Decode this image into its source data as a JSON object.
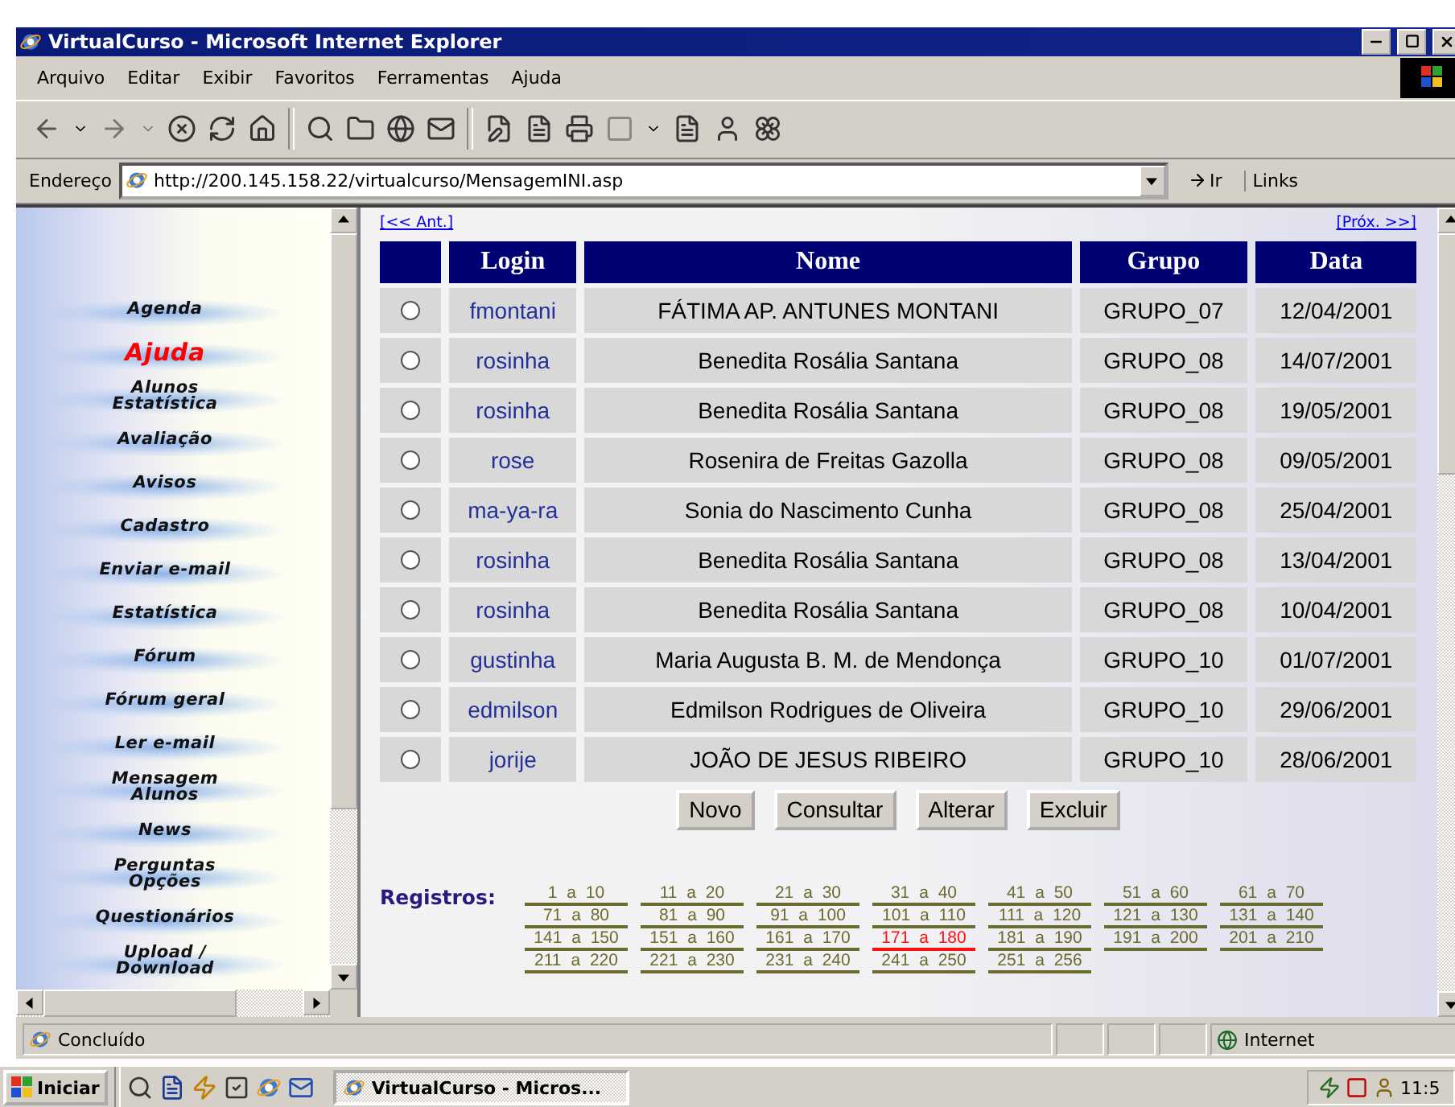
{
  "window": {
    "title": "VirtualCurso - Microsoft Internet Explorer"
  },
  "menu": [
    "Arquivo",
    "Editar",
    "Exibir",
    "Favoritos",
    "Ferramentas",
    "Ajuda"
  ],
  "address": {
    "label": "Endereço",
    "value": "http://200.145.158.22/virtualcurso/MensagemINI.asp",
    "go": "Ir",
    "links": "Links"
  },
  "sidebar": {
    "items": [
      {
        "lines": [
          "Agenda"
        ],
        "selected": false
      },
      {
        "lines": [
          "Ajuda"
        ],
        "selected": true
      },
      {
        "lines": [
          "Alunos",
          "Estatística"
        ],
        "selected": false
      },
      {
        "lines": [
          "Avaliação"
        ],
        "selected": false
      },
      {
        "lines": [
          "Avisos"
        ],
        "selected": false
      },
      {
        "lines": [
          "Cadastro"
        ],
        "selected": false
      },
      {
        "lines": [
          "Enviar e-mail"
        ],
        "selected": false
      },
      {
        "lines": [
          "Estatística"
        ],
        "selected": false
      },
      {
        "lines": [
          "Fórum"
        ],
        "selected": false
      },
      {
        "lines": [
          "Fórum geral"
        ],
        "selected": false
      },
      {
        "lines": [
          "Ler e-mail"
        ],
        "selected": false
      },
      {
        "lines": [
          "Mensagem",
          "Alunos"
        ],
        "selected": false
      },
      {
        "lines": [
          "News"
        ],
        "selected": false
      },
      {
        "lines": [
          "Perguntas",
          "Opções"
        ],
        "selected": false
      },
      {
        "lines": [
          "Questionários"
        ],
        "selected": false
      },
      {
        "lines": [
          "Upload /",
          "Download"
        ],
        "selected": false
      }
    ]
  },
  "content": {
    "prev": "[<< Ant.]",
    "next": "[Próx. >>]",
    "table": {
      "columns": [
        "Login",
        "Nome",
        "Grupo",
        "Data"
      ],
      "rows": [
        {
          "selected": false,
          "login": "fmontani",
          "nome": "FÁTIMA AP. ANTUNES MONTANI",
          "grupo": "GRUPO_07",
          "data": "12/04/2001"
        },
        {
          "selected": false,
          "login": "rosinha",
          "nome": "Benedita Rosália Santana",
          "grupo": "GRUPO_08",
          "data": "14/07/2001"
        },
        {
          "selected": false,
          "login": "rosinha",
          "nome": "Benedita Rosália Santana",
          "grupo": "GRUPO_08",
          "data": "19/05/2001"
        },
        {
          "selected": false,
          "login": "rose",
          "nome": "Rosenira de Freitas Gazolla",
          "grupo": "GRUPO_08",
          "data": "09/05/2001"
        },
        {
          "selected": false,
          "login": "ma-ya-ra",
          "nome": "Sonia do Nascimento Cunha",
          "grupo": "GRUPO_08",
          "data": "25/04/2001"
        },
        {
          "selected": false,
          "login": "rosinha",
          "nome": "Benedita Rosália Santana",
          "grupo": "GRUPO_08",
          "data": "13/04/2001"
        },
        {
          "selected": false,
          "login": "rosinha",
          "nome": "Benedita Rosália Santana",
          "grupo": "GRUPO_08",
          "data": "10/04/2001"
        },
        {
          "selected": false,
          "login": "gustinha",
          "nome": "Maria Augusta B. M. de Mendonça",
          "grupo": "GRUPO_10",
          "data": "01/07/2001"
        },
        {
          "selected": false,
          "login": "edmilson",
          "nome": "Edmilson Rodrigues de Oliveira",
          "grupo": "GRUPO_10",
          "data": "29/06/2001"
        },
        {
          "selected": false,
          "login": "jorije",
          "nome": "JOÃO DE JESUS RIBEIRO",
          "grupo": "GRUPO_10",
          "data": "28/06/2001"
        }
      ]
    },
    "buttons": [
      "Novo",
      "Consultar",
      "Alterar",
      "Excluir"
    ],
    "records": {
      "label": "Registros:",
      "pages": [
        {
          "label": "1 a 10",
          "selected": false
        },
        {
          "label": "11 a 20",
          "selected": false
        },
        {
          "label": "21 a 30",
          "selected": false
        },
        {
          "label": "31 a 40",
          "selected": false
        },
        {
          "label": "41 a 50",
          "selected": false
        },
        {
          "label": "51 a 60",
          "selected": false
        },
        {
          "label": "61 a 70",
          "selected": false
        },
        {
          "label": "71 a 80",
          "selected": false
        },
        {
          "label": "81 a 90",
          "selected": false
        },
        {
          "label": "91 a 100",
          "selected": false
        },
        {
          "label": "101 a 110",
          "selected": false
        },
        {
          "label": "111 a 120",
          "selected": false
        },
        {
          "label": "121 a 130",
          "selected": false
        },
        {
          "label": "131 a 140",
          "selected": false
        },
        {
          "label": "141 a 150",
          "selected": false
        },
        {
          "label": "151 a 160",
          "selected": false
        },
        {
          "label": "161 a 170",
          "selected": false
        },
        {
          "label": "171 a 180",
          "selected": true
        },
        {
          "label": "181 a 190",
          "selected": false
        },
        {
          "label": "191 a 200",
          "selected": false
        },
        {
          "label": "201 a 210",
          "selected": false
        },
        {
          "label": "211 a 220",
          "selected": false
        },
        {
          "label": "221 a 230",
          "selected": false
        },
        {
          "label": "231 a 240",
          "selected": false
        },
        {
          "label": "241 a 250",
          "selected": false
        },
        {
          "label": "251 a 256",
          "selected": false
        }
      ]
    }
  },
  "status_bar": {
    "text": "Concluído",
    "zone": "Internet"
  },
  "taskbar": {
    "start": "Iniciar",
    "task": "VirtualCurso - Micros...",
    "clock": "11:5"
  }
}
